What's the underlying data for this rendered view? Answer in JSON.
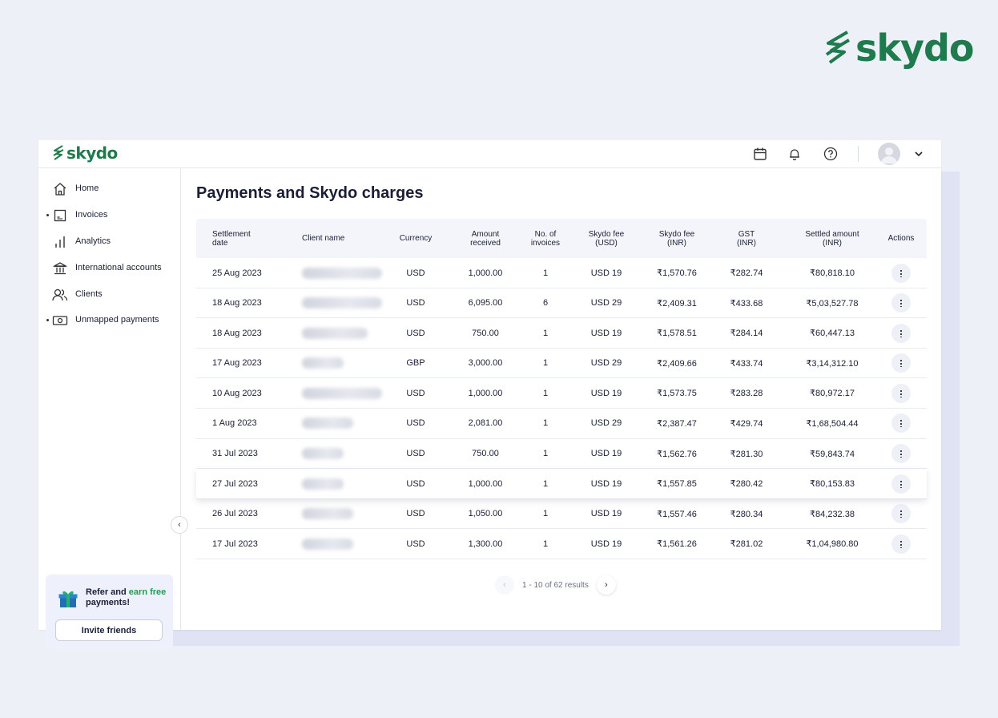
{
  "brand": {
    "name": "skydo",
    "color": "#1f7b4d"
  },
  "topbar": {
    "icons": [
      "calendar-icon",
      "bell-icon",
      "help-icon",
      "avatar",
      "chevron-down-icon"
    ]
  },
  "sidebar": {
    "items": [
      {
        "label": "Home",
        "icon": "home-icon"
      },
      {
        "label": "Invoices",
        "icon": "invoice-icon"
      },
      {
        "label": "Analytics",
        "icon": "analytics-icon"
      },
      {
        "label": "International accounts",
        "icon": "bank-icon"
      },
      {
        "label": "Clients",
        "icon": "clients-icon"
      },
      {
        "label": "Unmapped payments",
        "icon": "cash-icon"
      }
    ],
    "refer": {
      "prefix": "Refer and ",
      "highlight": "earn free",
      "suffix": "payments!",
      "button": "Invite friends"
    }
  },
  "main": {
    "title": "Payments and Skydo charges",
    "columns": [
      "Settlement date",
      "Client name",
      "Currency",
      "Amount received",
      "No. of invoices",
      "Skydo fee (USD)",
      "Skydo fee (INR)",
      "GST (INR)",
      "Settled amount (INR)",
      "Actions"
    ],
    "rows": [
      {
        "date": "25 Aug 2023",
        "currency": "USD",
        "amount": "1,000.00",
        "invoices": "1",
        "fee_usd": "USD 19",
        "fee_inr": "₹1,570.76",
        "gst": "₹282.74",
        "settled": "₹80,818.10"
      },
      {
        "date": "18 Aug 2023",
        "currency": "USD",
        "amount": "6,095.00",
        "invoices": "6",
        "fee_usd": "USD 29",
        "fee_inr": "₹2,409.31",
        "gst": "₹433.68",
        "settled": "₹5,03,527.78"
      },
      {
        "date": "18 Aug 2023",
        "currency": "USD",
        "amount": "750.00",
        "invoices": "1",
        "fee_usd": "USD 19",
        "fee_inr": "₹1,578.51",
        "gst": "₹284.14",
        "settled": "₹60,447.13"
      },
      {
        "date": "17 Aug 2023",
        "currency": "GBP",
        "amount": "3,000.00",
        "invoices": "1",
        "fee_usd": "USD 29",
        "fee_inr": "₹2,409.66",
        "gst": "₹433.74",
        "settled": "₹3,14,312.10"
      },
      {
        "date": "10 Aug 2023",
        "currency": "USD",
        "amount": "1,000.00",
        "invoices": "1",
        "fee_usd": "USD 19",
        "fee_inr": "₹1,573.75",
        "gst": "₹283.28",
        "settled": "₹80,972.17"
      },
      {
        "date": "1 Aug 2023",
        "currency": "USD",
        "amount": "2,081.00",
        "invoices": "1",
        "fee_usd": "USD 29",
        "fee_inr": "₹2,387.47",
        "gst": "₹429.74",
        "settled": "₹1,68,504.44"
      },
      {
        "date": "31 Jul 2023",
        "currency": "USD",
        "amount": "750.00",
        "invoices": "1",
        "fee_usd": "USD 19",
        "fee_inr": "₹1,562.76",
        "gst": "₹281.30",
        "settled": "₹59,843.74"
      },
      {
        "date": "27 Jul 2023",
        "currency": "USD",
        "amount": "1,000.00",
        "invoices": "1",
        "fee_usd": "USD 19",
        "fee_inr": "₹1,557.85",
        "gst": "₹280.42",
        "settled": "₹80,153.83"
      },
      {
        "date": "26 Jul 2023",
        "currency": "USD",
        "amount": "1,050.00",
        "invoices": "1",
        "fee_usd": "USD 19",
        "fee_inr": "₹1,557.46",
        "gst": "₹280.34",
        "settled": "₹84,232.38"
      },
      {
        "date": "17 Jul 2023",
        "currency": "USD",
        "amount": "1,300.00",
        "invoices": "1",
        "fee_usd": "USD 19",
        "fee_inr": "₹1,561.26",
        "gst": "₹281.02",
        "settled": "₹1,04,980.80"
      }
    ],
    "pagination": {
      "summary": "1 - 10 of 62 results",
      "prev": "‹",
      "next": "›"
    }
  }
}
